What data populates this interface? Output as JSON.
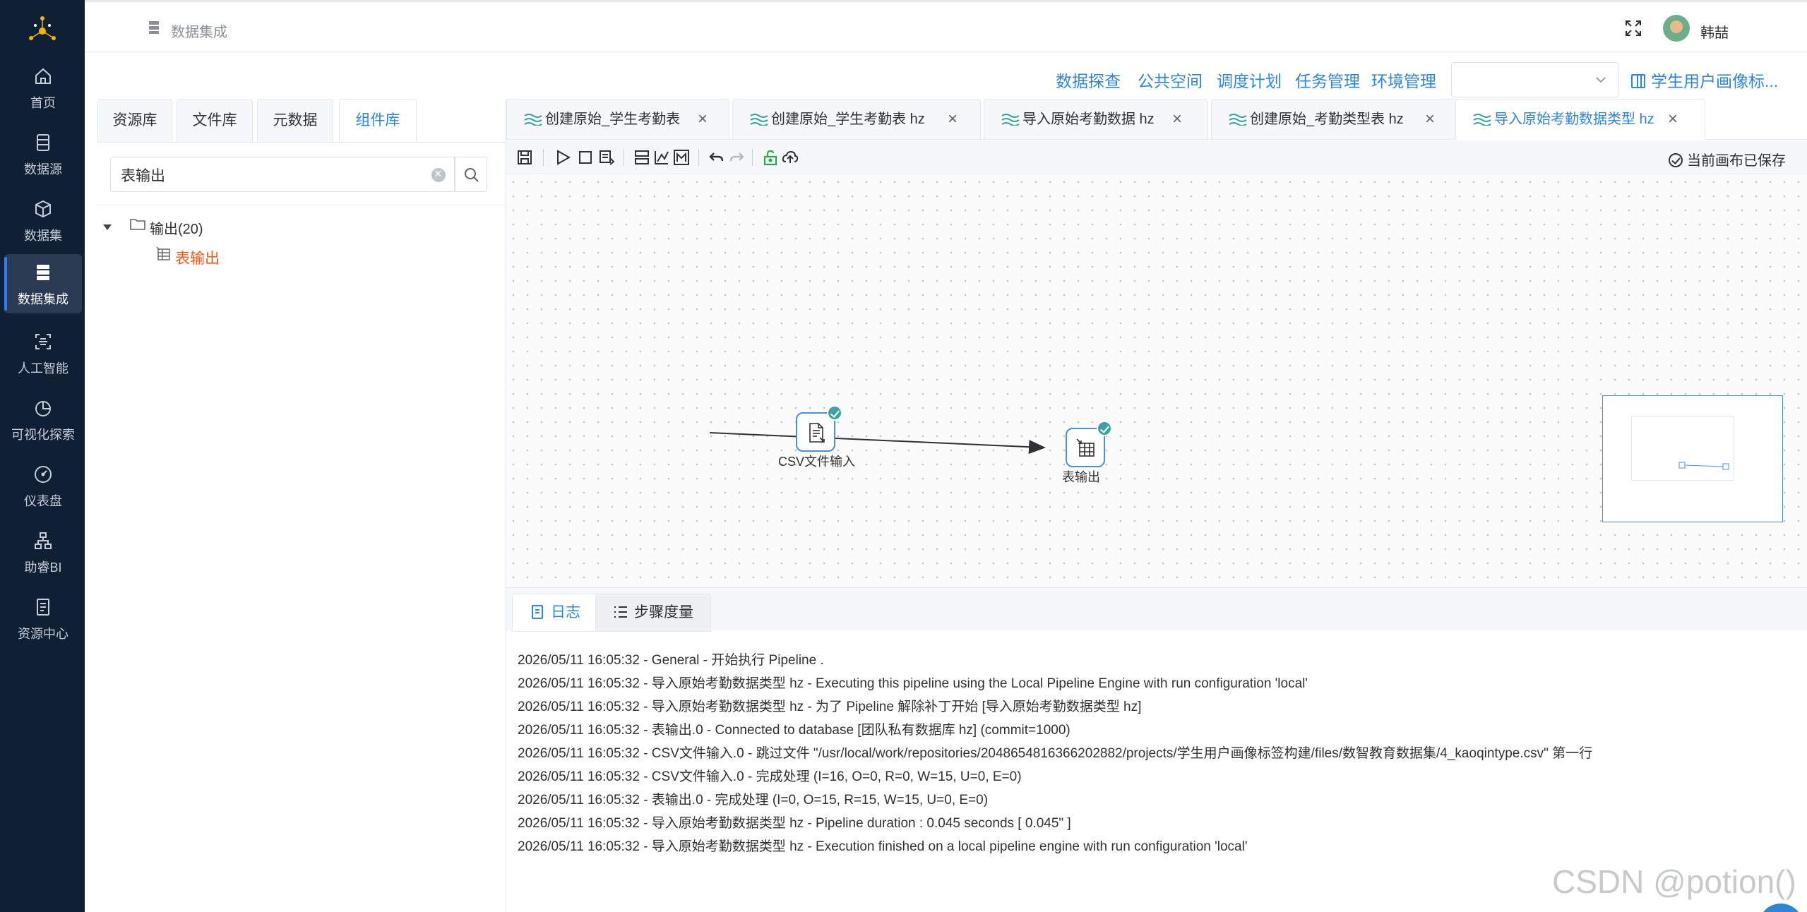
{
  "nav": {
    "items": [
      {
        "label": "首页",
        "icon": "home-icon"
      },
      {
        "label": "数据源",
        "icon": "database-icon"
      },
      {
        "label": "数据集",
        "icon": "cube-icon"
      },
      {
        "label": "数据集成",
        "icon": "server-icon",
        "active": true
      },
      {
        "label": "人工智能",
        "icon": "ai-scan-icon"
      },
      {
        "label": "可视化探索",
        "icon": "pie-chart-icon"
      },
      {
        "label": "仪表盘",
        "icon": "gauge-icon"
      },
      {
        "label": "助睿BI",
        "icon": "org-chart-icon"
      },
      {
        "label": "资源中心",
        "icon": "document-icon"
      }
    ]
  },
  "header": {
    "breadcrumb": "数据集成",
    "user_name": "韩喆"
  },
  "actions": {
    "links": [
      "数据探查",
      "公共空间",
      "调度计划",
      "任务管理",
      "环境管理"
    ],
    "project_select_value": "",
    "project_link": "学生用户画像标..."
  },
  "left_panel": {
    "tabs": [
      "资源库",
      "文件库",
      "元数据",
      "组件库"
    ],
    "active_tab": "组件库",
    "search_value": "表输出",
    "tree": {
      "folder_label": "输出(20)",
      "leaf_label": "表输出"
    }
  },
  "editor_tabs": [
    {
      "label": "创建原始_学生考勤表",
      "active": false
    },
    {
      "label": "创建原始_学生考勤表 hz",
      "active": false
    },
    {
      "label": "导入原始考勤数据 hz",
      "active": false
    },
    {
      "label": "创建原始_考勤类型表 hz",
      "active": false
    },
    {
      "label": "导入原始考勤数据类型 hz",
      "active": true
    }
  ],
  "toolbar": {
    "saved_status": "当前画布已保存"
  },
  "canvas": {
    "nodes": [
      {
        "label": "CSV文件输入",
        "icon": "csv-file-input-icon",
        "status": "success"
      },
      {
        "label": "表输出",
        "icon": "table-output-icon",
        "status": "success"
      }
    ]
  },
  "bottom_panel": {
    "tabs": [
      "日志",
      "步骤度量"
    ],
    "active_tab": "日志",
    "log_lines": [
      "2026/05/11 16:05:32 - General - 开始执行 Pipeline .",
      "2026/05/11 16:05:32 - 导入原始考勤数据类型 hz - Executing this pipeline using the Local Pipeline Engine with run configuration 'local'",
      "2026/05/11 16:05:32 - 导入原始考勤数据类型 hz - 为了 Pipeline 解除补丁开始 [导入原始考勤数据类型 hz]",
      "2026/05/11 16:05:32 - 表输出.0 - Connected to database [团队私有数据库 hz] (commit=1000)",
      "2026/05/11 16:05:32 - CSV文件输入.0 - 跳过文件 \"/usr/local/work/repositories/2048654816366202882/projects/学生用户画像标签构建/files/数智教育数据集/4_kaoqintype.csv\" 第一行",
      "2026/05/11 16:05:32 - CSV文件输入.0 - 完成处理 (I=16, O=0, R=0, W=15, U=0, E=0)",
      "2026/05/11 16:05:32 - 表输出.0 - 完成处理 (I=0, O=15, R=15, W=15, U=0, E=0)",
      "2026/05/11 16:05:32 - 导入原始考勤数据类型 hz - Pipeline duration : 0.045 seconds [  0.045\" ]",
      "2026/05/11 16:05:32 - 导入原始考勤数据类型 hz - Execution finished on a local pipeline engine with run configuration 'local'"
    ]
  },
  "watermark": "CSDN @potion()",
  "colors": {
    "nav_bg": "#0f2035",
    "accent": "#2f86d6",
    "highlight_orange": "#f05a1a",
    "success": "#3aa3a0"
  }
}
